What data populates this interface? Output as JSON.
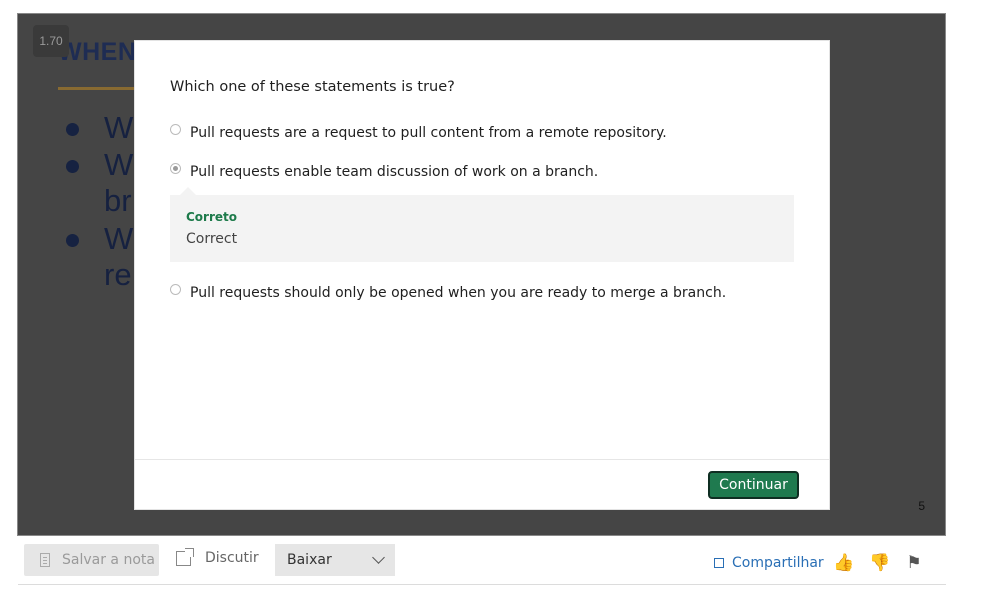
{
  "player": {
    "speed": "1.70",
    "slide_title": "WHEN",
    "bullets": [
      "W",
      "W",
      "br",
      "W",
      "re"
    ],
    "page_number": "5"
  },
  "quiz": {
    "question": "Which one of these statements is true?",
    "options": [
      {
        "label": "Pull requests are a request to pull content from a remote repository.",
        "selected": false
      },
      {
        "label": "Pull requests enable team discussion of work on a branch.",
        "selected": true
      },
      {
        "label": "Pull requests should only be opened when you are ready to merge a branch.",
        "selected": false
      }
    ],
    "feedback": {
      "title": "Correto",
      "text": "Correct"
    },
    "continue_label": "Continuar"
  },
  "toolbar": {
    "save_note": "Salvar a nota",
    "discuss": "Discutir",
    "download": "Baixar",
    "share": "Compartilhar",
    "icons": [
      "thumbs-up-icon",
      "thumbs-down-icon",
      "flag-icon"
    ]
  },
  "colors": {
    "accent_green": "#1f7a4f",
    "link_blue": "#2a6fb5",
    "correct_green": "#1d7a4a"
  }
}
